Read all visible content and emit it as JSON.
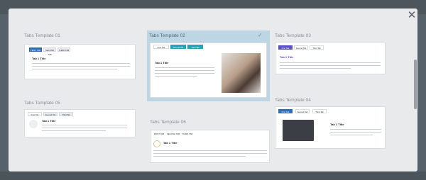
{
  "modal": {
    "close_glyph": "✕"
  },
  "templates": [
    {
      "label": "Tabs Template 01",
      "tabs": [
        "FIRST TAB",
        "SECOND TAB",
        "THIRD TAB"
      ],
      "content_title": "Tab 1 Title"
    },
    {
      "label": "Tabs Template 02",
      "tabs": [
        "First Tab",
        "Second Tab",
        "Third Tab"
      ],
      "content_title": "Tab 1 Title",
      "selected": true,
      "check_glyph": "✓"
    },
    {
      "label": "Tabs Template 03",
      "tabs": [
        "First Tab",
        "Second Tab",
        "Third Tab"
      ],
      "content_title": "Tab 1 Title"
    },
    {
      "label": "Tabs Template 05",
      "tabs": [
        "First Tab",
        "Second Tab",
        "Third Tab"
      ],
      "content_title": "Tab 1 Title"
    },
    {
      "label": "Tabs Template 06",
      "tabs": [
        "FIRST TAB",
        "SECOND TAB",
        "THIRD TAB"
      ],
      "content_title": "Tab 1 Title"
    },
    {
      "label": "Tabs Template 04",
      "tabs": [
        "First Tab",
        "Second Tab",
        "Third Tab"
      ],
      "content_title": "Tab 1 Title"
    }
  ]
}
